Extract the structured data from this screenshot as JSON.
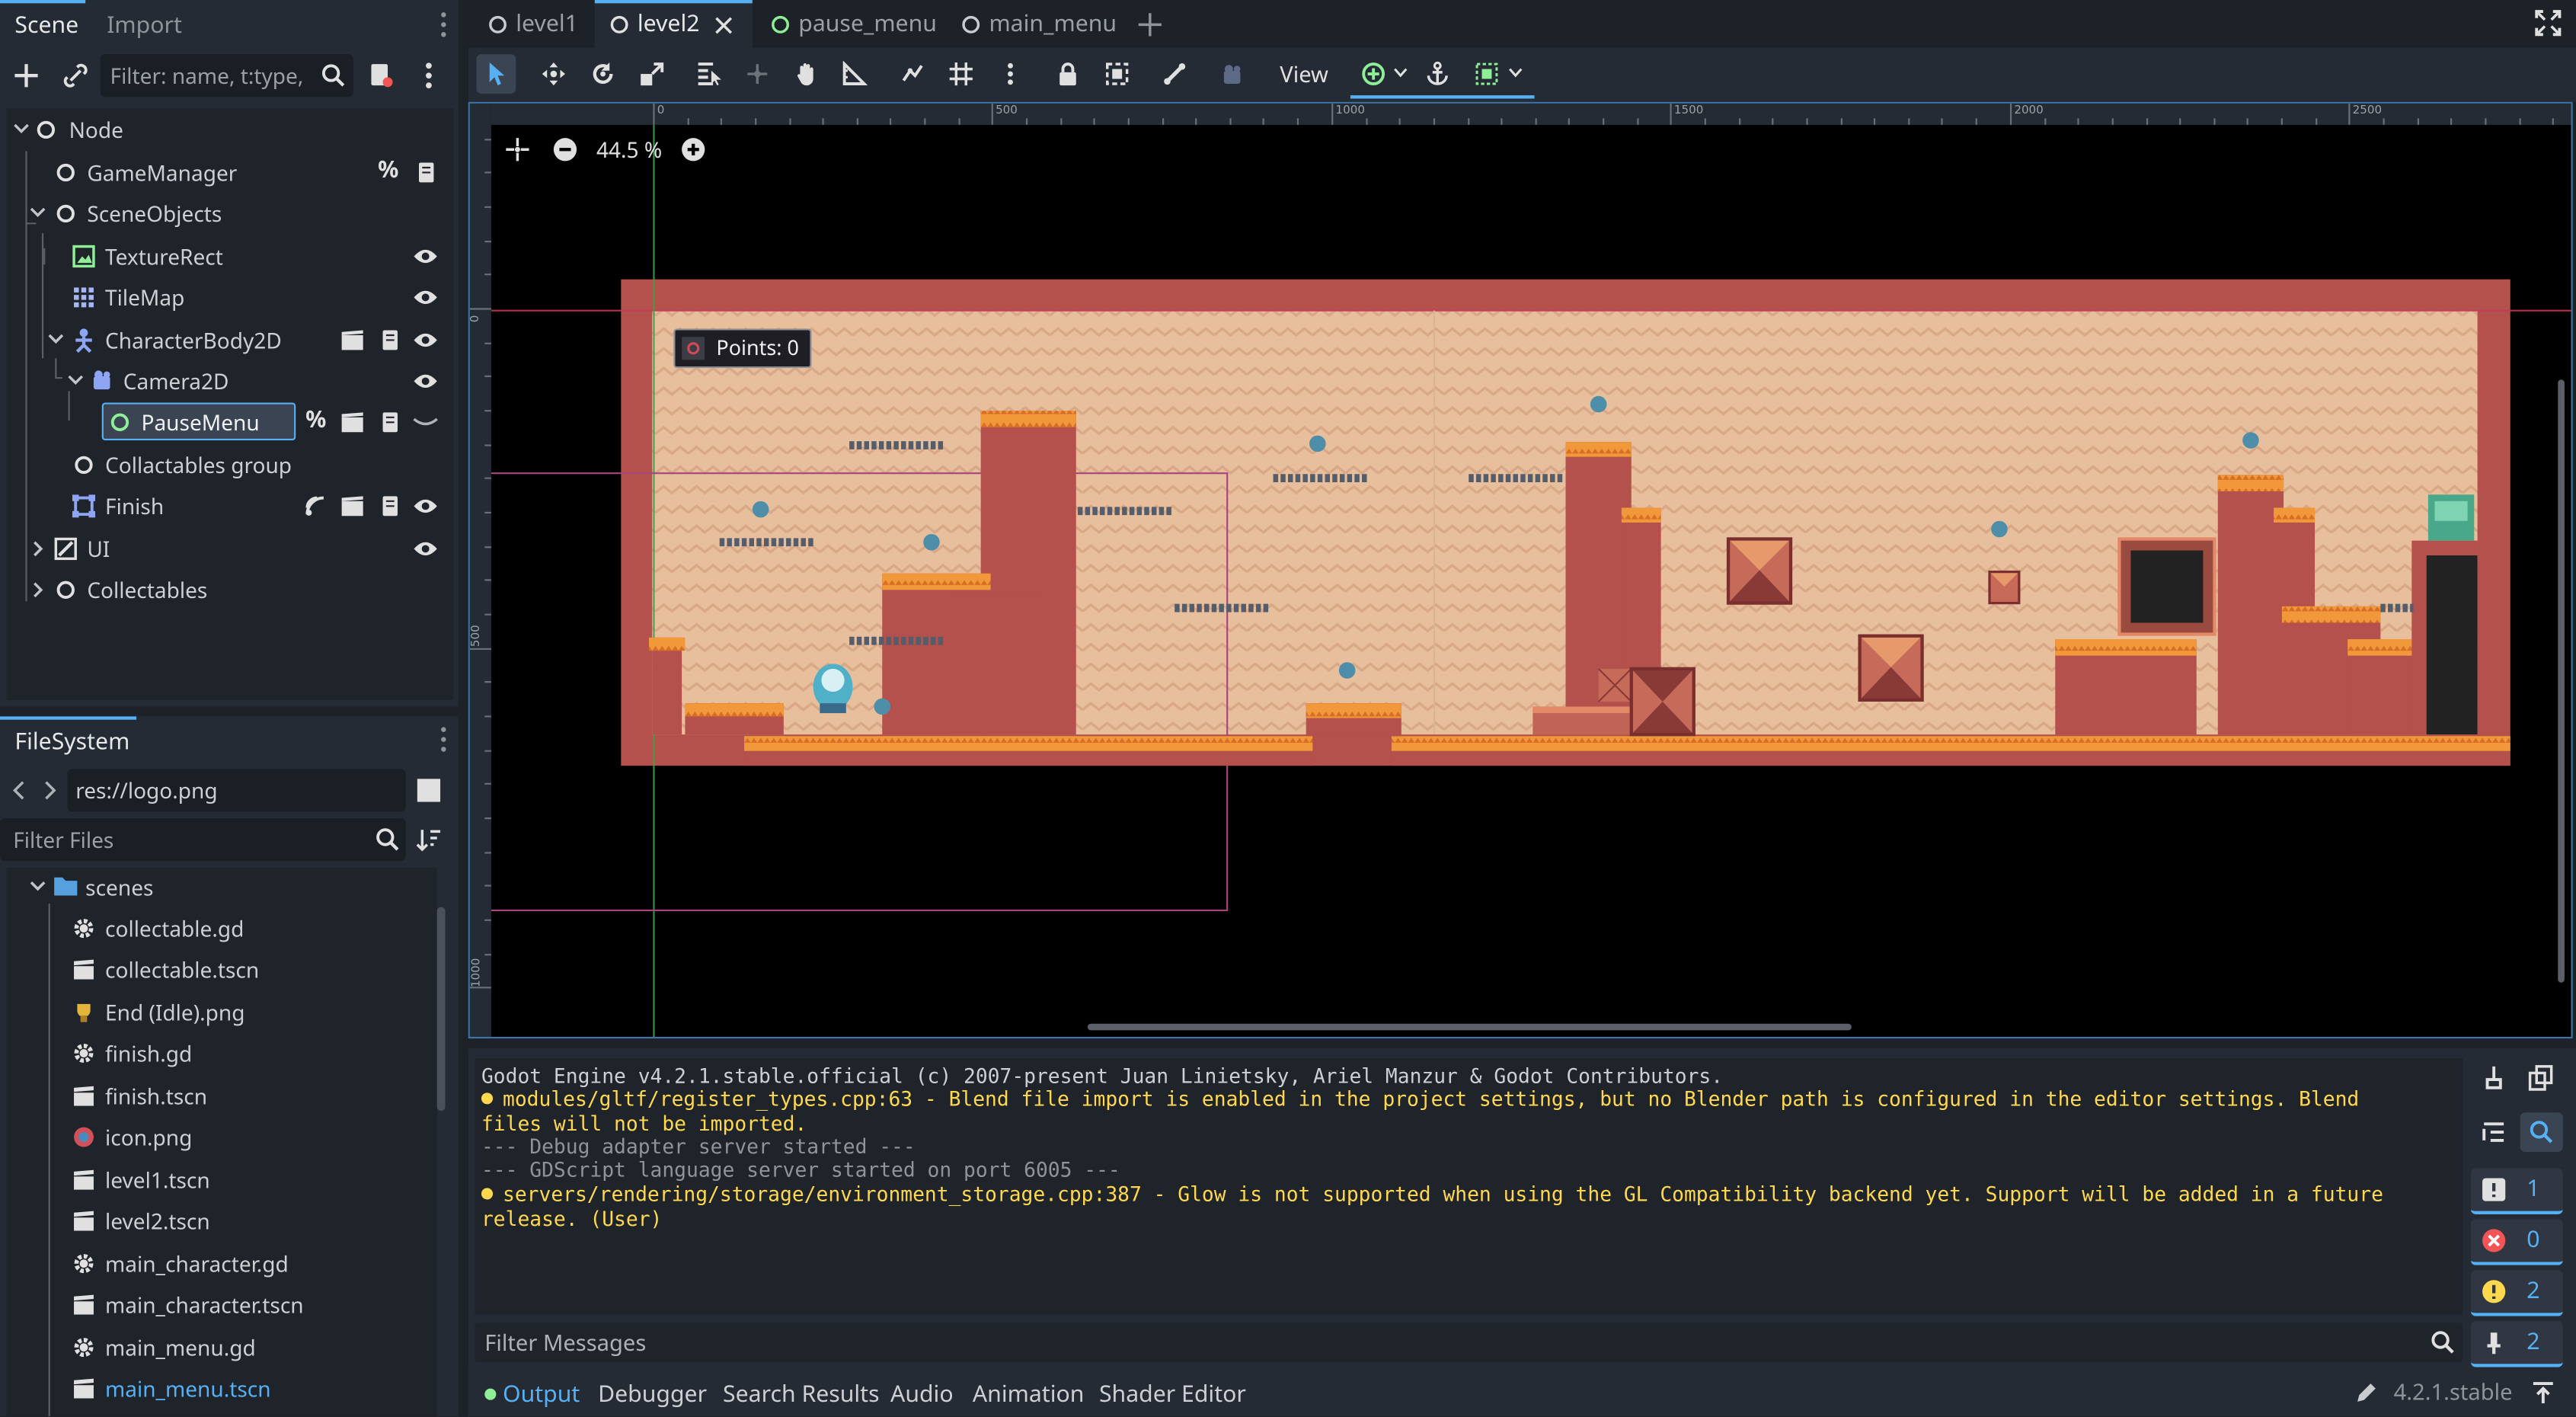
{
  "scene_dock": {
    "tabs": [
      "Scene",
      "Import"
    ],
    "filter_placeholder": "Filter: name, t:type,"
  },
  "scene_tree": [
    {
      "label": "Node"
    },
    {
      "label": "GameManager"
    },
    {
      "label": "SceneObjects"
    },
    {
      "label": "TextureRect"
    },
    {
      "label": "TileMap"
    },
    {
      "label": "CharacterBody2D"
    },
    {
      "label": "Camera2D"
    },
    {
      "label": "PauseMenu"
    },
    {
      "label": "Collactables group"
    },
    {
      "label": "Finish"
    },
    {
      "label": "UI"
    },
    {
      "label": "Collectables"
    }
  ],
  "filesystem": {
    "title": "FileSystem",
    "path": "res://logo.png",
    "filter_placeholder": "Filter Files",
    "folder": "scenes",
    "files": [
      "collectable.gd",
      "collectable.tscn",
      "End (Idle).png",
      "finish.gd",
      "finish.tscn",
      "icon.png",
      "level1.tscn",
      "level2.tscn",
      "main_character.gd",
      "main_character.tscn",
      "main_menu.gd",
      "main_menu.tscn"
    ]
  },
  "editor_tabs": [
    "level1",
    "level2",
    "pause_menu",
    "main_menu"
  ],
  "toolbar": {
    "view_label": "View"
  },
  "viewport": {
    "zoom": "44.5 %",
    "points_label": "Points: 0",
    "ruler_h": [
      "0",
      "500",
      "1000",
      "1500",
      "2000",
      "2500"
    ],
    "ruler_v": [
      "0",
      "500",
      "1000"
    ]
  },
  "output": {
    "lines": [
      "Godot Engine v4.2.1.stable.official (c) 2007-present Juan Linietsky, Ariel Manzur & Godot Contributors.",
      "modules/gltf/register_types.cpp:63 - Blend file import is enabled in the project settings, but no Blender path is configured in the editor settings. Blend files will not be imported.",
      "--- Debug adapter server started ---",
      "--- GDScript language server started on port 6005 ---",
      "servers/rendering/storage/environment_storage.cpp:387 - Glow is not supported when using the GL Compatibility backend yet. Support will be added in a future release. (User)"
    ],
    "filter_placeholder": "Filter Messages",
    "counts": {
      "messages": "1",
      "errors": "0",
      "warnings": "2",
      "editor": "2"
    }
  },
  "bottom_tabs": [
    "Output",
    "Debugger",
    "Search Results",
    "Audio",
    "Animation",
    "Shader Editor"
  ],
  "version": "4.2.1.stable",
  "colors": {
    "accent": "#56b0f4",
    "warning": "#ffd84d",
    "error": "#f25555",
    "panel": "#252b34",
    "background": "#1d2229"
  }
}
